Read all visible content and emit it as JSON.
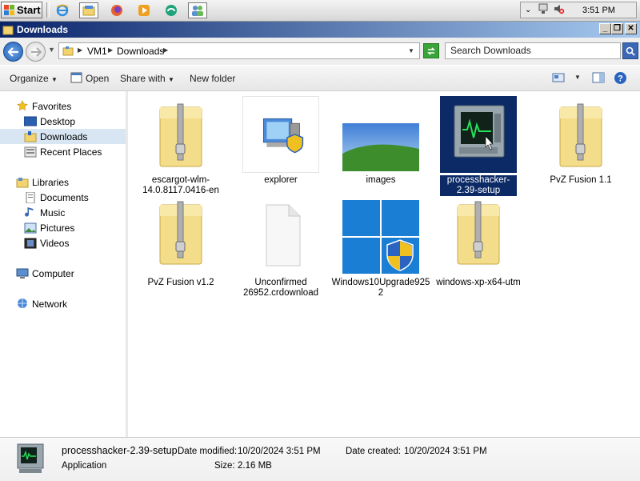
{
  "taskbar": {
    "start_label": "Start",
    "quick_launch": [
      "ie-icon",
      "explorer-icon",
      "firefox-icon",
      "media-player-icon",
      "edge-icon",
      "users-icon"
    ],
    "clock": "3:51 PM"
  },
  "window": {
    "title": "Downloads"
  },
  "address": {
    "segments": [
      "VM1",
      "Downloads"
    ],
    "search_placeholder": "Search Downloads"
  },
  "toolbar": {
    "organize": "Organize",
    "open": "Open",
    "share_with": "Share with",
    "new_folder": "New folder"
  },
  "nav": {
    "favorites": "Favorites",
    "desktop": "Desktop",
    "downloads": "Downloads",
    "recent_places": "Recent Places",
    "libraries": "Libraries",
    "documents": "Documents",
    "music": "Music",
    "pictures": "Pictures",
    "videos": "Videos",
    "computer": "Computer",
    "network": "Network"
  },
  "files": [
    {
      "name": "escargot-wlm-14.0.8117.0416-en",
      "icon": "zip-folder-icon"
    },
    {
      "name": "explorer",
      "icon": "explorer-app-icon"
    },
    {
      "name": "images",
      "icon": "image-thumbnail-icon"
    },
    {
      "name": "processhacker-2.39-setup",
      "icon": "process-hacker-icon",
      "selected": true
    },
    {
      "name": "PvZ Fusion 1.1",
      "icon": "zip-folder-icon"
    },
    {
      "name": "PvZ Fusion v1.2",
      "icon": "zip-folder-icon"
    },
    {
      "name": "Unconfirmed 26952.crdownload",
      "icon": "blank-file-icon"
    },
    {
      "name": "Windows10Upgrade9252",
      "icon": "windows-installer-icon"
    },
    {
      "name": "windows-xp-x64-utm",
      "icon": "zip-folder-icon"
    }
  ],
  "details": {
    "name": "processhacker-2.39-setup",
    "type": "Application",
    "date_modified_label": "Date modified:",
    "date_modified": "10/20/2024 3:51 PM",
    "size_label": "Size:",
    "size": "2.16 MB",
    "date_created_label": "Date created:",
    "date_created": "10/20/2024 3:51 PM"
  },
  "colors": {
    "selection": "#0b2a66",
    "title_bar": "#0a246a",
    "nav_selected": "#d8e6f3"
  }
}
